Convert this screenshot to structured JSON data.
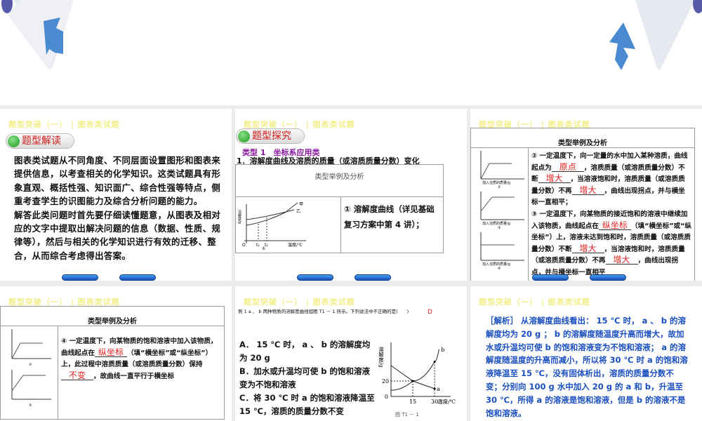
{
  "header": "题型突破（一） | 图表类试题",
  "slide1": {
    "badge": "题型解读",
    "body": "图表类试题从不同角度、不同层面设置图形和图表来提供信息，以考查相关的化学知识。这类试题具有形象直观、概括性强、知识面广、综合性强等特点，侧重考查学生的识图能力及综合分析问题的能力。",
    "body2": "解答此类问题时首先要仔细读懂题意，从图表及相对应的文字中提取出解决问题的信息（数据、性质、规律等），然后与相关的化学知识进行有效的迁移、整合，从而综合考虑得出答案。"
  },
  "slide2": {
    "badge": "题型探究",
    "type_label": "类型 1　坐标系应用类",
    "subtitle": "1．溶解度曲线及溶质的质量（或溶质质量分数）变化",
    "table_header": "类型举例及分析",
    "cell_text": "① 溶解度曲线（详见基础复习方案中第 4 讲）；",
    "fig_labels": {
      "y": "溶解度/g",
      "x": "温度/℃",
      "jia": "甲",
      "yi": "乙",
      "num": "①",
      "t1": "t₁",
      "t2": "t₂",
      "o": "O"
    }
  },
  "slide3": {
    "table_header": "类型举例及分析",
    "p2a": "② 一定温度下，向一定量的水中加入某种溶质，曲线起点为",
    "p2b": "，溶质质量（或溶质质量分数）不断",
    "p2c": "，当溶液饱和时，溶质质量（或溶质质量分数）不再",
    "p2d": "，曲线出现拐点，并与横坐标一直相平；",
    "ans1": "原点",
    "ans2": "增大",
    "ans3": "增大",
    "p3a": "③ 一定温度下，向某物质的接近饱和的溶液中继续加入该物质，曲线起点在",
    "p3b": "（填“横坐标”或“纵坐标”）上，溶液未达到饱和时，溶质质量（或溶质质量分数）不断",
    "p3c": "，当溶液饱和时，溶质质量（或溶质质量分数）不再",
    "p3d": "，曲线出现拐点，并与横坐标一直相平",
    "ans4": "纵坐标",
    "ans5": "增大",
    "ans6": "增大",
    "fig_x": "加入溶质的质量/g",
    "fig_y": "溶质质量(或溶质质量分数)",
    "n2": "②",
    "n3": "③",
    "n4": "④"
  },
  "slide4": {
    "table_header": "类型举例及分析",
    "p4a": "④ 一定温度下，向某物质的饱和溶液中加入该物质，曲线起点在",
    "p4b": "（填“横坐标”或“纵坐标”）上，此过程中溶质质量（或溶质质量分数）保持",
    "p4c": "，故曲线一直平行于横坐标",
    "ans1": "纵坐标",
    "ans2": "不变"
  },
  "slide5": {
    "question": "例 1  a 、 b 两种物质的溶解度曲线如图 T1 － 1 所示。下列说法中不正确的是(　　)",
    "answer": "D",
    "optA": "A． 15 ℃ 时， a 、 b 的溶解度均为 20 g",
    "optB": "B．加水或升温均可使 b 的饱和溶液变为不饱和溶液",
    "optC": "C．将 30 ℃ 时 a 的饱和溶液降温至 15 ℃，溶质的质量分数不变",
    "caption": "图 T1 － 1"
  },
  "slide6": {
    "analysis": "［解析］ 从溶解度曲线看出： 15 ℃ 时， a 、 b 的溶解度均为 20 g ； b 的溶解度随温度升高而增大，故加水或升温均可使 b 的饱和溶液变为不饱和溶液； a 的溶解度随温度的升高而减小，所以将 30 ℃ 时 a 的饱和溶液降温至 15 ℃，没有固体析出，溶质的质量分数不变；分别向 100 g 水中加入 20 g 的 a 和 b，升温至 30 ℃，所得 a 的溶液是饱和溶液，但是 b 的溶液不是饱和溶液。"
  },
  "chart_data": {
    "type": "line",
    "xlabel": "温度/℃",
    "ylabel": "溶解度/g",
    "x_ticks": [
      "0",
      "15",
      "30"
    ],
    "y_ticks": [
      "20"
    ],
    "series": [
      {
        "name": "a",
        "x": [
          0,
          15,
          30
        ],
        "y": [
          40,
          20,
          10
        ]
      },
      {
        "name": "b",
        "x": [
          0,
          15,
          30,
          33
        ],
        "y": [
          8,
          20,
          45,
          61
        ]
      }
    ],
    "xlim": [
      0,
      35
    ],
    "ylim": [
      0,
      68
    ]
  },
  "colors": {
    "header": "#f3ee8c",
    "answer": "#e02020",
    "analysis": "#1a4fc0",
    "type": "#8a1aa0"
  }
}
